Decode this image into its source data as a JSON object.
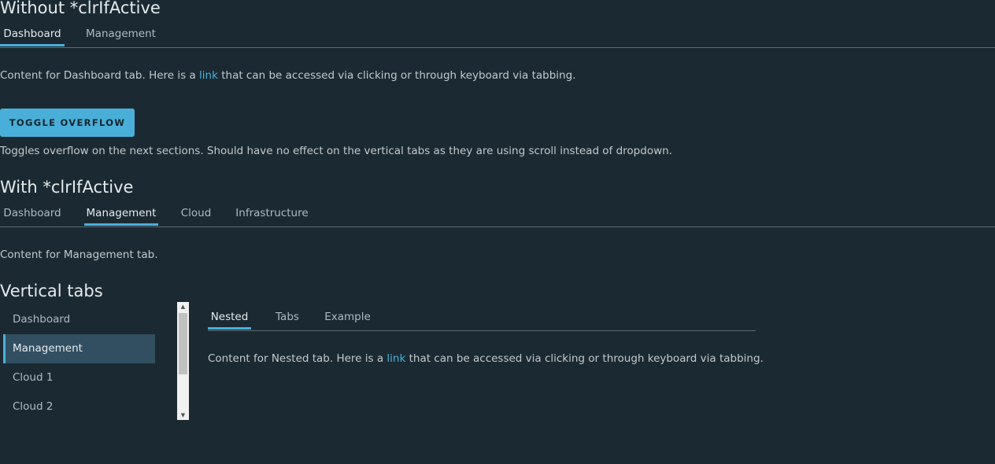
{
  "section1": {
    "title": "Without *clrIfActive",
    "tabs": [
      "Dashboard",
      "Management"
    ],
    "content_before": "Content for Dashboard tab. Here is a ",
    "link": "link",
    "content_after": " that can be accessed via clicking or through keyboard via tabbing."
  },
  "toggle": {
    "button_label": "TOGGLE OVERFLOW",
    "description": "Toggles overflow on the next sections. Should have no effect on the vertical tabs as they are using scroll instead of dropdown."
  },
  "section2": {
    "title": "With *clrIfActive",
    "tabs": [
      "Dashboard",
      "Management",
      "Cloud",
      "Infrastructure"
    ],
    "content": "Content for Management tab."
  },
  "section3": {
    "title": "Vertical tabs",
    "vertical_items": [
      "Dashboard",
      "Management",
      "Cloud 1",
      "Cloud 2"
    ],
    "nested_tabs": [
      "Nested",
      "Tabs",
      "Example"
    ],
    "content_before": "Content for Nested tab. Here is a ",
    "link": "link",
    "content_after": " that can be accessed via clicking or through keyboard via tabbing."
  },
  "colors": {
    "background": "#1b2a32",
    "accent": "#49afd9",
    "active_vertical_bg": "#324f62"
  },
  "icons": {
    "scroll_up": "▲",
    "scroll_down": "▼"
  }
}
